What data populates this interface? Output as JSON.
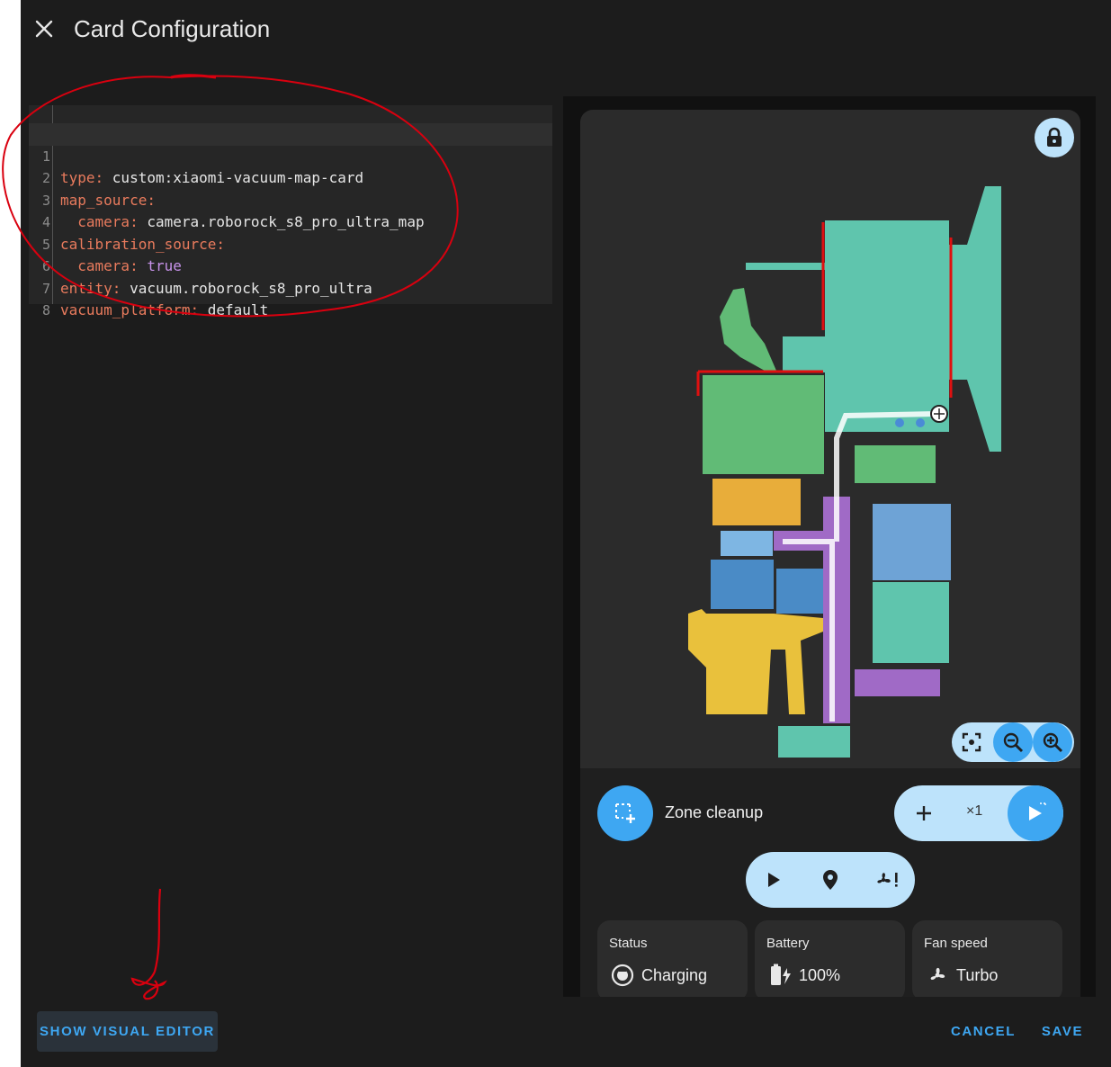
{
  "dialog": {
    "title": "Card Configuration"
  },
  "yaml_lines": [
    {
      "num": "1",
      "key": "type",
      "value": "custom:xiaomi-vacuum-map-card"
    },
    {
      "num": "2",
      "key": "map_source",
      "value": ""
    },
    {
      "num": "3",
      "key": "camera",
      "value": "camera.roborock_s8_pro_ultra_map"
    },
    {
      "num": "4",
      "key": "calibration_source",
      "value": ""
    },
    {
      "num": "5",
      "key": "camera",
      "value": "true"
    },
    {
      "num": "6",
      "key": "entity",
      "value": "vacuum.roborock_s8_pro_ultra"
    },
    {
      "num": "7",
      "key": "vacuum_platform",
      "value": "default"
    },
    {
      "num": "8",
      "key": "",
      "value": ""
    }
  ],
  "card": {
    "mode_label": "Zone cleanup",
    "repeat_label": "×1",
    "tiles": [
      {
        "title": "Status",
        "value": "Charging",
        "icon": "robot-vacuum-icon"
      },
      {
        "title": "Battery",
        "value": "100%",
        "icon": "battery-charging-icon"
      },
      {
        "title": "Fan speed",
        "value": "Turbo",
        "icon": "fan-icon"
      }
    ]
  },
  "footer": {
    "show_visual_editor": "SHOW VISUAL EDITOR",
    "cancel": "CANCEL",
    "save": "SAVE"
  },
  "colors": {
    "accent": "#3ea7f2",
    "pill": "#bde3fb",
    "yaml_key": "#e97b5d",
    "yaml_bool": "#c792ea",
    "annotation": "#d9000f"
  }
}
